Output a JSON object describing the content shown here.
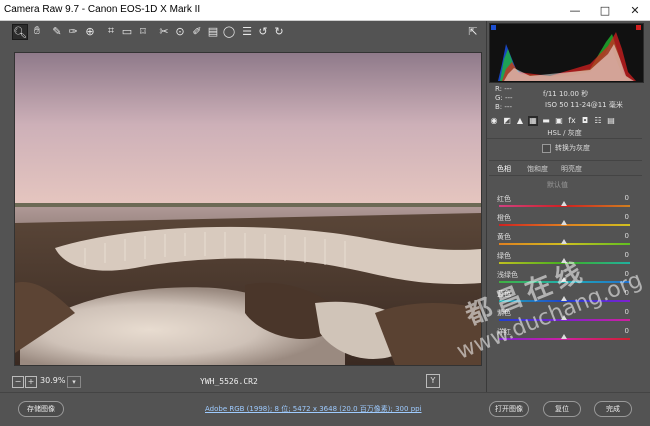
{
  "window": {
    "title": "Camera Raw 9.7 -  Canon EOS-1D X Mark II",
    "minimize": "—",
    "maximize": "□",
    "close": "✕"
  },
  "toolbar": {
    "tools": [
      "zoom-tool",
      "hand-tool",
      "white-balance-tool",
      "color-sampler-tool",
      "targeted-adjustment-tool",
      "crop-tool",
      "straighten-tool",
      "transform-tool",
      "spot-removal-tool",
      "red-eye-tool",
      "adjustment-brush-tool",
      "graduated-filter-tool",
      "radial-filter-tool",
      "presets-list",
      "rotate-left",
      "rotate-right"
    ],
    "fullscreen_icon": "fullscreen-icon"
  },
  "readout": {
    "rgb": [
      "R: ---",
      "G: ---",
      "B: ---"
    ],
    "exif_line1": "f/11  10.00 秒",
    "exif_line2": "ISO 50  11-24@11 毫米"
  },
  "panel": {
    "header": "HSL / 灰度",
    "grayscale_checkbox": "转换为灰度",
    "tabs": [
      "色相",
      "饱和度",
      "明亮度"
    ],
    "adjust_label": "默认值",
    "sliders": [
      {
        "label": "红色",
        "value": "0",
        "gradient": "linear-gradient(90deg,#d04080,#d02020,#d08020)"
      },
      {
        "label": "橙色",
        "value": "0",
        "gradient": "linear-gradient(90deg,#d02020,#e08020,#d0c020)"
      },
      {
        "label": "黄色",
        "value": "0",
        "gradient": "linear-gradient(90deg,#e08020,#d0c020,#60c020)"
      },
      {
        "label": "绿色",
        "value": "0",
        "gradient": "linear-gradient(90deg,#c0c020,#40b020,#20b0a0)"
      },
      {
        "label": "浅绿色",
        "value": "0",
        "gradient": "linear-gradient(90deg,#40b040,#20b0b0,#2070d0)"
      },
      {
        "label": "蓝色",
        "value": "0",
        "gradient": "linear-gradient(90deg,#20b0b0,#2040d0,#8020d0)"
      },
      {
        "label": "紫色",
        "value": "0",
        "gradient": "linear-gradient(90deg,#2040d0,#8020d0,#d020a0)"
      },
      {
        "label": "洋红",
        "value": "0",
        "gradient": "linear-gradient(90deg,#8020d0,#d020a0,#d02030)"
      }
    ]
  },
  "status": {
    "zoom": "30.9%",
    "filename": "YWH_5526.CR2",
    "y_label": "Y"
  },
  "bottom": {
    "save_button": "存储图像",
    "workflow_link": "Adobe RGB (1998); 8 位; 5472 x 3648 (20.0 百万像素); 300 ppi",
    "open_button": "打开图像",
    "reset_button": "复位",
    "done_button": "完成"
  },
  "watermark": {
    "line1": "都昌在线",
    "line2": "www.duchang.org"
  }
}
